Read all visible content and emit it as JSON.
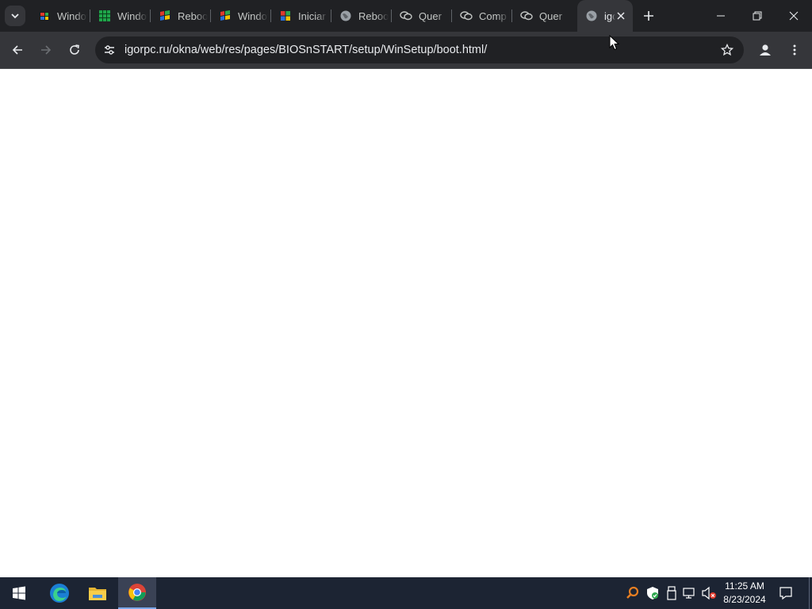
{
  "browser": {
    "tabs": [
      {
        "title": "Windows",
        "favicon": "windows-flag-icon",
        "active": false
      },
      {
        "title": "Windows",
        "favicon": "green-grid-icon",
        "active": false
      },
      {
        "title": "Reboot",
        "favicon": "windows-xp-flag-icon",
        "active": false
      },
      {
        "title": "Windows",
        "favicon": "windows-xp-flag-icon",
        "active": false
      },
      {
        "title": "Iniciar",
        "favicon": "windows-flag-icon",
        "active": false
      },
      {
        "title": "Reboot",
        "favicon": "globe-icon",
        "active": false
      },
      {
        "title": "Quer",
        "favicon": "chat-bubbles-icon",
        "active": false
      },
      {
        "title": "Comp",
        "favicon": "chat-bubbles-icon",
        "active": false
      },
      {
        "title": "Quer",
        "favicon": "chat-bubbles-icon",
        "active": false
      },
      {
        "title": "igorpc.ru",
        "favicon": "globe-icon",
        "active": true
      }
    ],
    "address": {
      "url": "igorpc.ru/okna/web/res/pages/BIOSnSTART/setup/WinSetup/boot.html/"
    },
    "colors": {
      "frame": "#202124",
      "toolbar": "#35363a",
      "text": "#e8eaed"
    }
  },
  "taskbar": {
    "pinned": [
      {
        "name": "start-button",
        "icon": "windows-logo-icon"
      },
      {
        "name": "taskbar-edge",
        "icon": "edge-icon"
      },
      {
        "name": "taskbar-file-explorer",
        "icon": "folder-icon"
      },
      {
        "name": "taskbar-chrome",
        "icon": "chrome-icon",
        "active": true
      }
    ],
    "clock": {
      "time": "11:25 AM",
      "date": "8/23/2024"
    }
  }
}
